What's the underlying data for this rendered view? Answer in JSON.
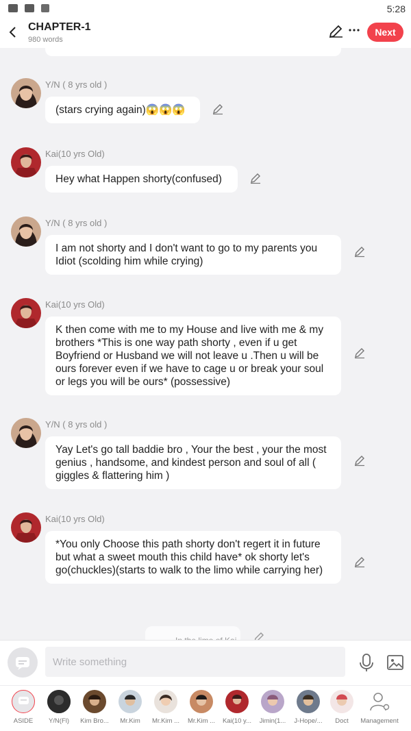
{
  "status_bar": {
    "time": "5:28"
  },
  "header": {
    "title": "CHAPTER-1",
    "word_count": "980 words",
    "next_label": "Next"
  },
  "messages": [
    {
      "speaker": "Y/N ( 8 yrs old )",
      "text": "(stars crying again)😱😱😱"
    },
    {
      "speaker": "Kai(10 yrs Old)",
      "text": "Hey what Happen shorty(confused)"
    },
    {
      "speaker": "Y/N ( 8 yrs old )",
      "text": "I am not shorty and I don't want to go to my parents you Idiot (scolding him while crying)"
    },
    {
      "speaker": "Kai(10 yrs Old)",
      "text": "K then come with me to my House and live with me & my brothers *This is one way path shorty , even if u  get Boyfriend or Husband we will not leave u .Then u will be ours forever even if we have to cage u or break your soul or legs you will be ours* (possessive)"
    },
    {
      "speaker": "Y/N ( 8 yrs old )",
      "text": "Yay Let's go tall baddie bro , Your the best , your the most genius , handsome, and kindest person and soul of all ( giggles & flattering him )"
    },
    {
      "speaker": "Kai(10 yrs Old)",
      "text": "*You only Choose this path shorty don't regert it in future but what a sweet mouth this child have* ok shorty let's go(chuckles)(starts to walk to the limo while carrying her)"
    }
  ],
  "partial_message": {
    "text": "In the limo of Kai"
  },
  "composer": {
    "placeholder": "Write something"
  },
  "characters": [
    {
      "name": "ASIDE"
    },
    {
      "name": "Y/N(Fl)"
    },
    {
      "name": "Kim Bro..."
    },
    {
      "name": "Mr.Kim"
    },
    {
      "name": "Mr.Kim ..."
    },
    {
      "name": "Mr.Kim ..."
    },
    {
      "name": "Kai(10 y..."
    },
    {
      "name": "Jimin(1..."
    },
    {
      "name": "J-Hope/..."
    },
    {
      "name": "Doct"
    },
    {
      "name": "Management"
    }
  ],
  "colors": {
    "accent": "#f2424c",
    "background": "#f2f2f4",
    "bubble": "#ffffff"
  }
}
